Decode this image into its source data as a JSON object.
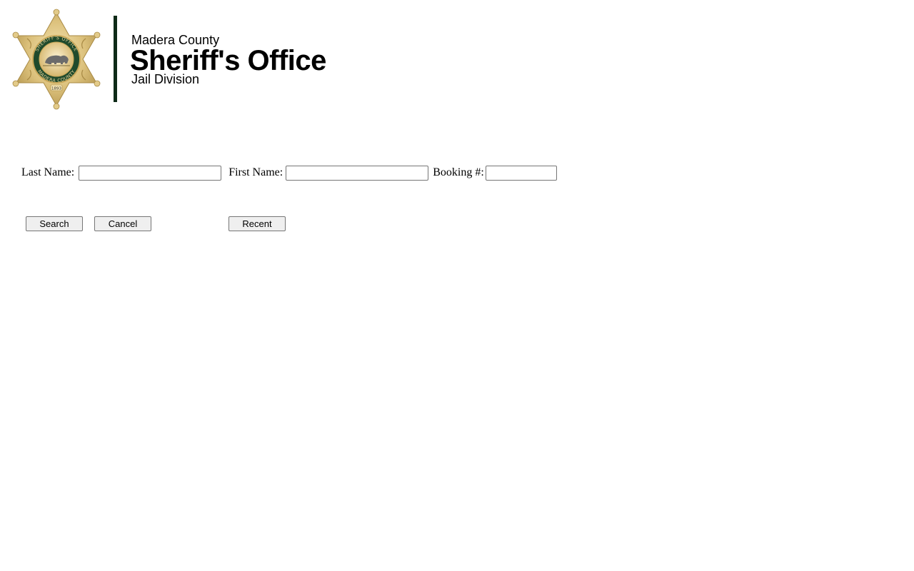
{
  "header": {
    "county": "Madera County",
    "office": "Sheriff's Office",
    "division": "Jail Division",
    "badge": {
      "top_text": "SHERIFF'S OFFICE",
      "bottom_text": "MADERA COUNTY",
      "year": "1893",
      "icon": "sheriff-star-badge-icon",
      "gold_color": "#d9bf7a",
      "green_color": "#1f4a2c"
    },
    "divider_color": "#0e2a17"
  },
  "search_form": {
    "last_name_label": "Last Name:",
    "last_name_value": "",
    "first_name_label": "First Name:",
    "first_name_value": "",
    "booking_label": "Booking #:",
    "booking_value": ""
  },
  "buttons": {
    "search_label": "Search",
    "cancel_label": "Cancel",
    "recent_label": "Recent"
  }
}
